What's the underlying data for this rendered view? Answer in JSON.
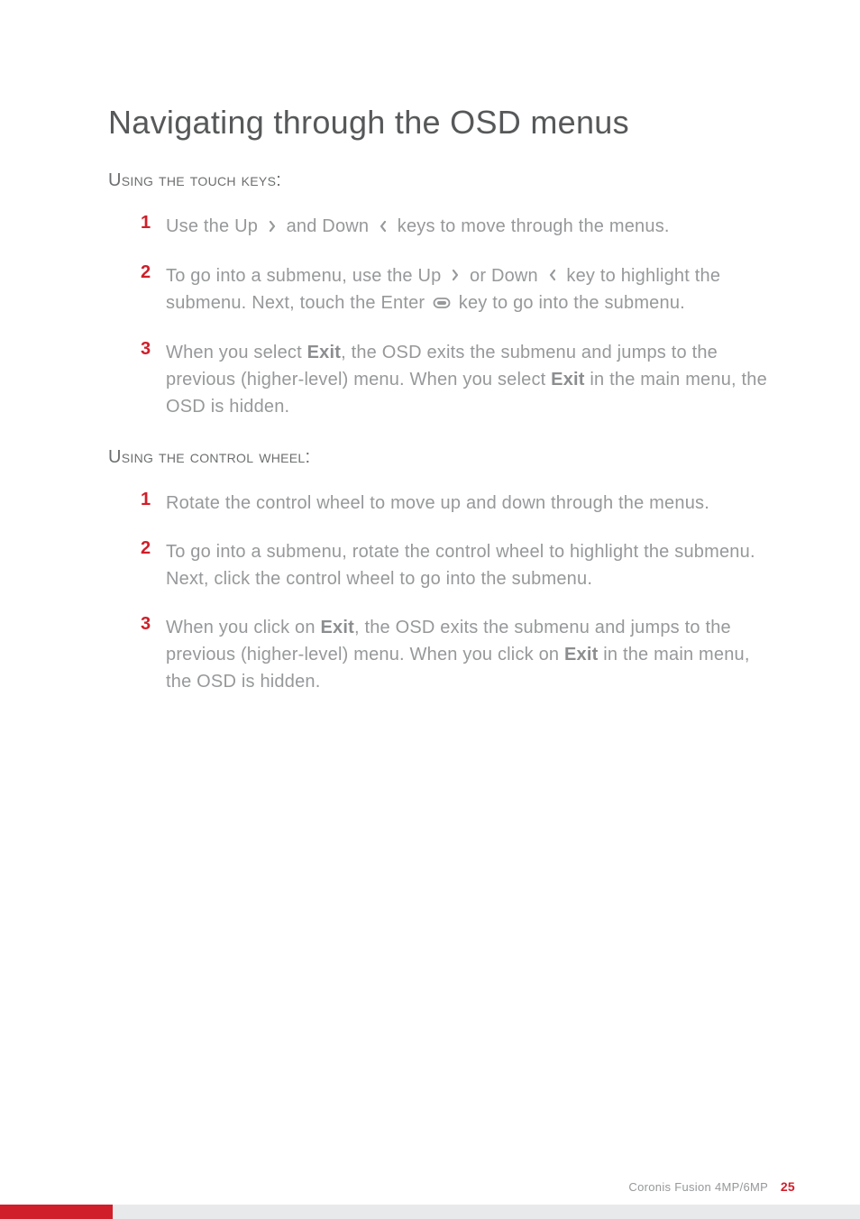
{
  "title": "Navigating through the OSD menus",
  "sections": [
    {
      "heading": "Using the touch keys:",
      "items": [
        {
          "number": "1",
          "text_parts": [
            {
              "type": "text",
              "content": "Use the Up "
            },
            {
              "type": "icon",
              "name": "up-chevron"
            },
            {
              "type": "text",
              "content": " and Down "
            },
            {
              "type": "icon",
              "name": "down-chevron"
            },
            {
              "type": "text",
              "content": " keys to move through the menus."
            }
          ]
        },
        {
          "number": "2",
          "text_parts": [
            {
              "type": "text",
              "content": "To go into a submenu, use the Up "
            },
            {
              "type": "icon",
              "name": "up-chevron"
            },
            {
              "type": "text",
              "content": " or Down "
            },
            {
              "type": "icon",
              "name": "down-chevron"
            },
            {
              "type": "text",
              "content": " key to highlight the submenu. Next, touch the Enter "
            },
            {
              "type": "icon",
              "name": "enter-key"
            },
            {
              "type": "text",
              "content": " key to go into the submenu."
            }
          ]
        },
        {
          "number": "3",
          "text_parts": [
            {
              "type": "text",
              "content": "When you select "
            },
            {
              "type": "bold",
              "content": "Exit"
            },
            {
              "type": "text",
              "content": ", the OSD exits the submenu and jumps to the previous (higher-level) menu. When you select "
            },
            {
              "type": "bold",
              "content": "Exit"
            },
            {
              "type": "text",
              "content": " in the main menu, the OSD is hidden."
            }
          ]
        }
      ]
    },
    {
      "heading": "Using the control wheel:",
      "items": [
        {
          "number": "1",
          "text_parts": [
            {
              "type": "text",
              "content": "Rotate the control wheel to move up and down through the menus."
            }
          ]
        },
        {
          "number": "2",
          "text_parts": [
            {
              "type": "text",
              "content": "To go into a submenu, rotate the control wheel to highlight the submenu. Next, click the control wheel to go into the submenu."
            }
          ]
        },
        {
          "number": "3",
          "text_parts": [
            {
              "type": "text",
              "content": "When you click on "
            },
            {
              "type": "bold",
              "content": "Exit"
            },
            {
              "type": "text",
              "content": ", the OSD exits the submenu and jumps to the previous (higher-level) menu. When you click on "
            },
            {
              "type": "bold",
              "content": "Exit"
            },
            {
              "type": "text",
              "content": " in the main menu, the OSD is hidden."
            }
          ]
        }
      ]
    }
  ],
  "footer": {
    "product_name": "Coronis Fusion 4MP/6MP",
    "page_number": "25"
  },
  "icons": {
    "up-chevron": "<svg width='14' height='14' viewBox='0 0 14 14'><path d='M 5 2 L 9 7 L 5 12' stroke='#96989a' stroke-width='2.2' fill='none' stroke-linecap='round' stroke-linejoin='round'/></svg>",
    "down-chevron": "<svg width='14' height='14' viewBox='0 0 14 14'><path d='M 9 2 L 5 7 L 9 12' stroke='#96989a' stroke-width='2.2' fill='none' stroke-linecap='round' stroke-linejoin='round'/></svg>",
    "enter-key": "<svg width='20' height='14' viewBox='0 0 20 14'><rect x='1.5' y='2' width='17' height='10' rx='5' ry='5' stroke='#96989a' stroke-width='1.8' fill='none'/><rect x='5' y='5' width='10' height='4' rx='2' ry='2' fill='#96989a'/></svg>"
  }
}
